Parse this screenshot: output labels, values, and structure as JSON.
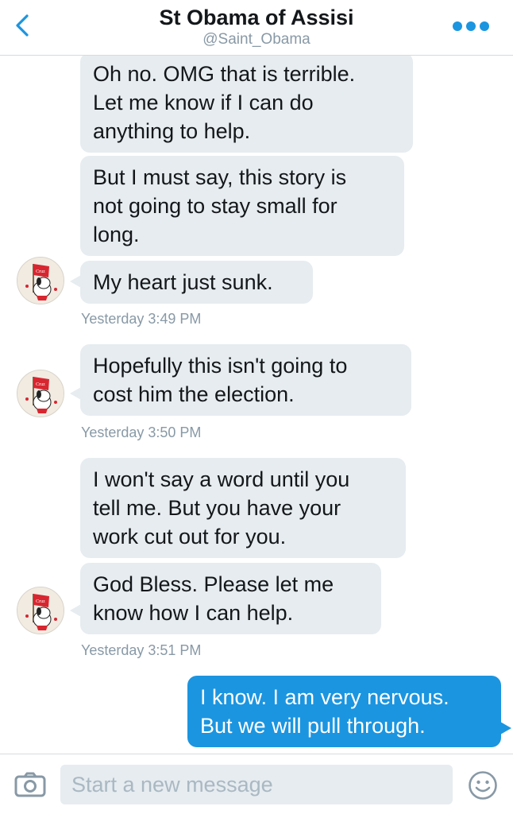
{
  "header": {
    "title": "St Obama of Assisi",
    "handle": "@Saint_Obama"
  },
  "messages": [
    {
      "text": "Oh no. OMG that is terrible.\nLet me know if I can do\nanything to help."
    },
    {
      "text": "But I must say, this story is\nnot going to stay small for\nlong."
    },
    {
      "text": "My heart just sunk."
    },
    {
      "text": "Hopefully this isn't going to\ncost him the election."
    },
    {
      "text": "I won't say a word until you\ntell me. But you have your\nwork cut out for you."
    },
    {
      "text": "God Bless. Please let me\nknow how I can help."
    },
    {
      "text": "I know. I am very nervous.\nBut we will pull through."
    }
  ],
  "timestamps": [
    "Yesterday 3:49 PM",
    "Yesterday 3:50 PM",
    "Yesterday 3:51 PM"
  ],
  "avatar_flag_text": "Cruz",
  "composer": {
    "placeholder": "Start a new message"
  },
  "colors": {
    "accent": "#1b95e0",
    "incoming_bubble": "#e6ecf0",
    "timestamp": "#8899a6"
  },
  "icons": {
    "back": "chevron-left-icon",
    "more": "more-dots-icon",
    "camera": "camera-icon",
    "emoji": "emoji-smile-icon"
  }
}
